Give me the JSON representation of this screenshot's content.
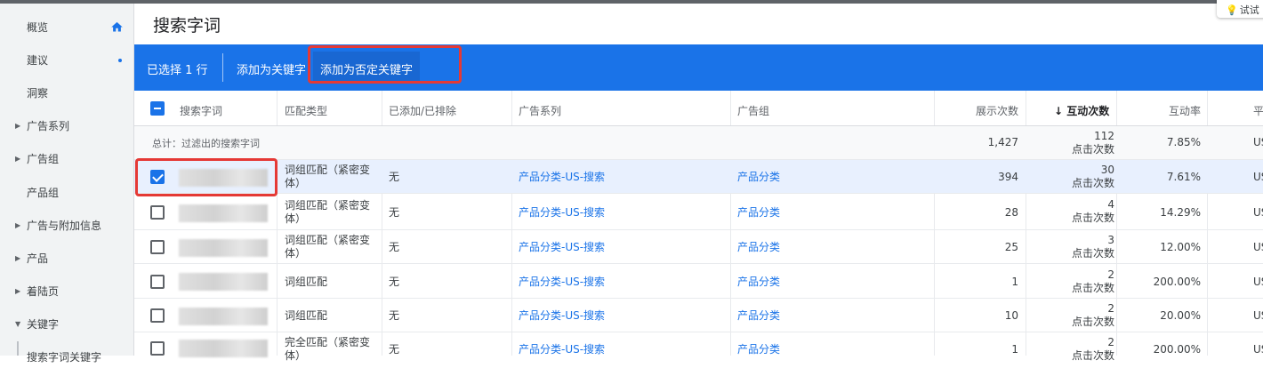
{
  "sidebar": {
    "items": [
      {
        "label": "概览",
        "caret": false
      },
      {
        "label": "建议",
        "caret": false
      },
      {
        "label": "洞察",
        "caret": false
      },
      {
        "label": "广告系列",
        "caret": true
      },
      {
        "label": "广告组",
        "caret": true
      },
      {
        "label": "产品组",
        "caret": false
      },
      {
        "label": "广告与附加信息",
        "caret": true
      },
      {
        "label": "产品",
        "caret": true
      },
      {
        "label": "着陆页",
        "caret": true
      },
      {
        "label": "关键字",
        "caret": true,
        "expanded": true
      }
    ],
    "sub_item": "搜索字词关键字"
  },
  "header": {
    "title": "搜索字词",
    "try_label": "试试"
  },
  "actionbar": {
    "selected": "已选择 1 行",
    "add_keyword": "添加为关键字",
    "add_negative": "添加为否定关键字"
  },
  "table": {
    "columns": {
      "search_term": "搜索字词",
      "match_type": "匹配类型",
      "added": "已添加/已排除",
      "campaign": "广告系列",
      "adgroup": "广告组",
      "impressions": "展示次数",
      "interactions": "互动次数",
      "interaction_rate": "互动率",
      "next": "平"
    },
    "total": {
      "label": "总计：过滤出的搜索字词",
      "impressions": "1,427",
      "interactions": "112",
      "interactions_sub": "点击次数",
      "rate": "7.85%",
      "next": "US"
    },
    "rows": [
      {
        "checked": true,
        "match1": "词组匹配（紧密变",
        "match2": "体）",
        "added": "无",
        "campaign": "产品分类-US-搜索",
        "adgroup": "产品分类",
        "impressions": "394",
        "interactions": "30",
        "interactions_sub": "点击次数",
        "rate": "7.61%",
        "next": "US"
      },
      {
        "checked": false,
        "match1": "词组匹配（紧密变",
        "match2": "体）",
        "added": "无",
        "campaign": "产品分类-US-搜索",
        "adgroup": "产品分类",
        "impressions": "28",
        "interactions": "4",
        "interactions_sub": "点击次数",
        "rate": "14.29%",
        "next": "US"
      },
      {
        "checked": false,
        "match1": "词组匹配（紧密变",
        "match2": "体）",
        "added": "无",
        "campaign": "产品分类-US-搜索",
        "adgroup": "产品分类",
        "impressions": "25",
        "interactions": "3",
        "interactions_sub": "点击次数",
        "rate": "12.00%",
        "next": "US"
      },
      {
        "checked": false,
        "match1": "词组匹配",
        "match2": "",
        "added": "无",
        "campaign": "产品分类-US-搜索",
        "adgroup": "产品分类",
        "impressions": "1",
        "interactions": "2",
        "interactions_sub": "点击次数",
        "rate": "200.00%",
        "next": "US"
      },
      {
        "checked": false,
        "match1": "词组匹配",
        "match2": "",
        "added": "无",
        "campaign": "产品分类-US-搜索",
        "adgroup": "产品分类",
        "impressions": "10",
        "interactions": "2",
        "interactions_sub": "点击次数",
        "rate": "20.00%",
        "next": "US"
      },
      {
        "checked": false,
        "match1": "完全匹配（紧密变",
        "match2": "体）",
        "added": "无",
        "campaign": "产品分类-US-搜索",
        "adgroup": "产品分类",
        "impressions": "1",
        "interactions": "2",
        "interactions_sub": "点击次数",
        "rate": "200.00%",
        "next": "US"
      }
    ]
  },
  "colors": {
    "accent": "#1a73e8",
    "highlight": "#e53935"
  },
  "icons": {
    "home": "home-icon",
    "sort": "arrow-down-icon",
    "bulb": "lightbulb-icon"
  }
}
